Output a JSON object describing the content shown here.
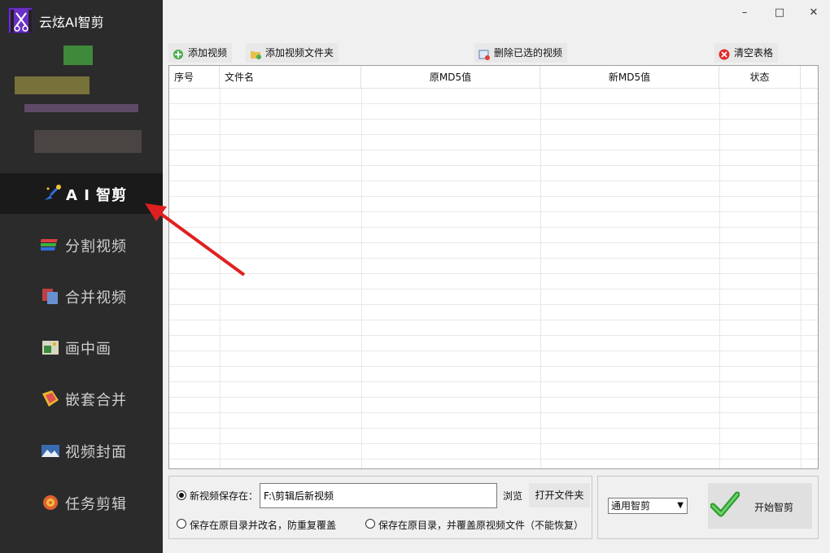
{
  "app": {
    "title": "云炫AI智剪"
  },
  "window_controls": {
    "minimize": "–",
    "maximize": "□",
    "close": "✕"
  },
  "sidebar": {
    "items": [
      {
        "label": "A I 智剪",
        "icon": "ai-magic-icon",
        "active": true
      },
      {
        "label": "分割视频",
        "icon": "split-video-icon",
        "active": false
      },
      {
        "label": "合并视频",
        "icon": "merge-video-icon",
        "active": false
      },
      {
        "label": "画中画",
        "icon": "picture-in-picture-icon",
        "active": false
      },
      {
        "label": "嵌套合并",
        "icon": "nested-merge-icon",
        "active": false
      },
      {
        "label": "视频封面",
        "icon": "video-cover-icon",
        "active": false
      },
      {
        "label": "任务剪辑",
        "icon": "task-edit-icon",
        "active": false
      }
    ]
  },
  "toolbar": {
    "add_video": "添加视频",
    "add_folder": "添加视频文件夹",
    "delete_selected": "删除已选的视频",
    "clear_table": "清空表格"
  },
  "table": {
    "columns": [
      "序号",
      "文件名",
      "原MD5值",
      "新MD5值",
      "状态"
    ],
    "rows": []
  },
  "save_options": {
    "new_location_label": "新视频保存在：",
    "path_value": "F:\\剪辑后新视频",
    "browse": "浏览",
    "open_folder": "打开文件夹",
    "rename_option": "保存在原目录并改名，防重复覆盖",
    "overwrite_option": "保存在原目录，并覆盖原视频文件（不能恢复）",
    "selected": "new_location"
  },
  "action": {
    "mode": "通用智剪",
    "start": "开始智剪"
  },
  "colors": {
    "sidebar_bg": "#2b2b2b",
    "active_item_bg": "#1a1a1a",
    "highlight_red": "#e02020",
    "logo_purple": "#6a2fc4"
  }
}
